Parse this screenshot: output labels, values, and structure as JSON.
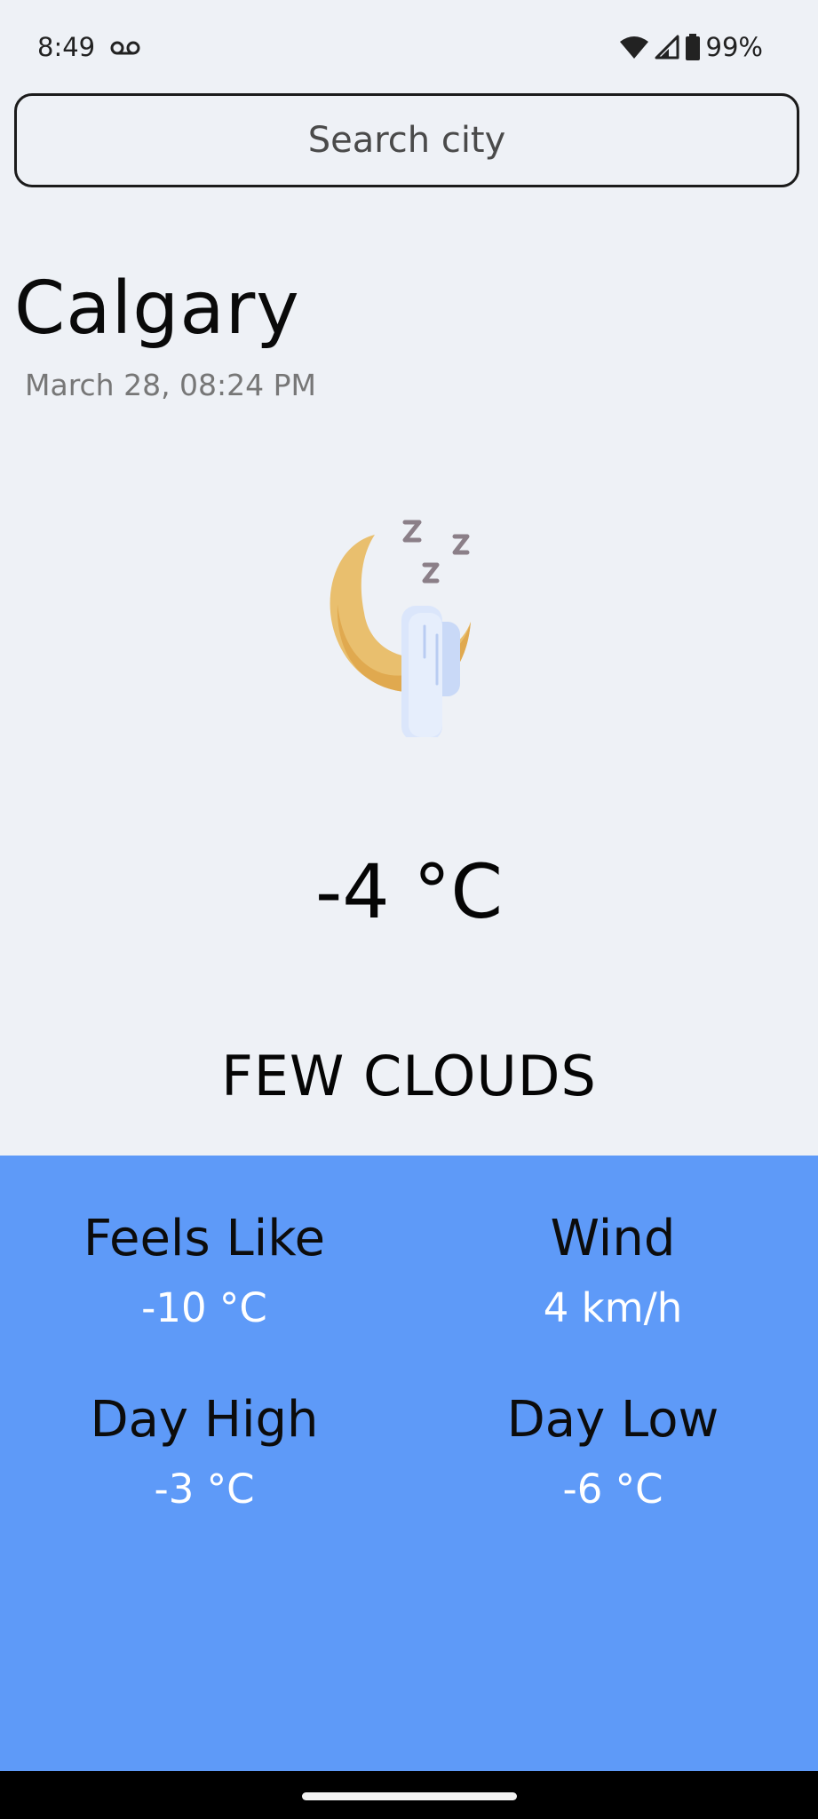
{
  "status_bar": {
    "time": "8:49",
    "battery": "99%",
    "icons": [
      "voicemail-icon",
      "wifi-icon",
      "cell-signal-icon",
      "battery-icon"
    ]
  },
  "search": {
    "placeholder": "Search city",
    "value": ""
  },
  "location": {
    "city": "Calgary",
    "datetime": "March 28, 08:24 PM"
  },
  "current": {
    "icon": "sleeping-moon-cloud-icon",
    "temperature": "-4 °C",
    "description": "FEW CLOUDS"
  },
  "details": {
    "feels_like": {
      "label": "Feels Like",
      "value": "-10 °C"
    },
    "wind": {
      "label": "Wind",
      "value": "4 km/h"
    },
    "day_high": {
      "label": "Day High",
      "value": "-3 °C"
    },
    "day_low": {
      "label": "Day Low",
      "value": "-6 °C"
    }
  },
  "colors": {
    "background": "#eef1f6",
    "panel": "#5e9af8",
    "moon": "#e9bf6e",
    "cloud": "#dde8fb"
  }
}
